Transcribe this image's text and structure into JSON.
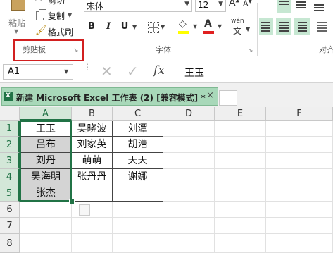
{
  "clipboard": {
    "paste_label": "粘贴",
    "cut_label": "剪切",
    "copy_label": "复制",
    "format_painter_label": "格式刷",
    "group_label": "剪贴板"
  },
  "font": {
    "name": "宋体",
    "size": "12",
    "group_label": "字体",
    "bold": "B",
    "italic": "I",
    "underline": "U",
    "phonetic": "wén",
    "font_color": "#e02020",
    "fill_color": "#ffff00"
  },
  "alignment": {
    "group_label": "对齐"
  },
  "formula_bar": {
    "name_box": "A1",
    "fx": "fx",
    "content": "王玉"
  },
  "workbook_tab": {
    "title": "新建 Microsoft Excel 工作表 (2)  [兼容模式] *",
    "close": "×"
  },
  "sheet": {
    "columns": [
      "A",
      "B",
      "C",
      "D",
      "E",
      "F"
    ],
    "rows": [
      "1",
      "2",
      "3",
      "4",
      "5",
      "6",
      "7",
      "8"
    ],
    "cells": [
      [
        "王玉",
        "吴晓波",
        "刘潭"
      ],
      [
        "吕布",
        "刘家英",
        "胡浩"
      ],
      [
        "刘丹",
        "萌萌",
        "天天"
      ],
      [
        "吴海明",
        "张丹丹",
        "谢娜"
      ],
      [
        "张杰",
        "",
        ""
      ]
    ],
    "selection_fill": "#d4d4d4",
    "selection_border": "#217346"
  }
}
